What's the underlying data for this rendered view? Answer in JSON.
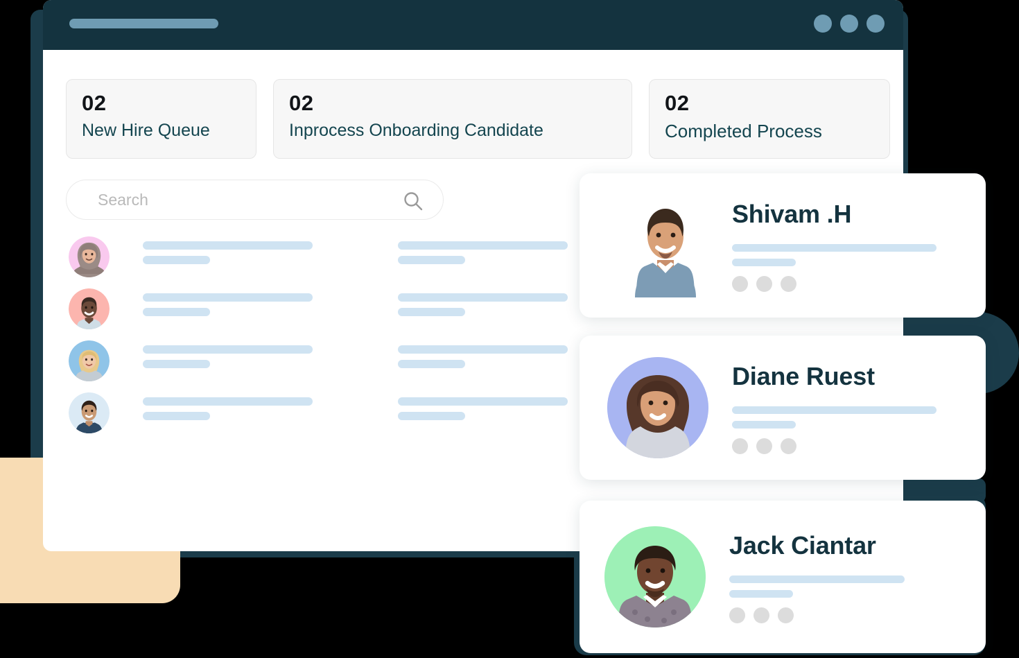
{
  "window": {
    "titlebar": {
      "pill": "",
      "dots": [
        "window-dot-1",
        "window-dot-2",
        "window-dot-3"
      ],
      "dot_color": "#6f9cb3",
      "background": "#14333f"
    }
  },
  "stats": [
    {
      "value": "02",
      "label": "New Hire Queue"
    },
    {
      "value": "02",
      "label": "Inprocess Onboarding Candidate"
    },
    {
      "value": "02",
      "label": "Completed Process"
    }
  ],
  "search": {
    "placeholder": "Search",
    "value": "",
    "icon": "search-icon"
  },
  "list_rows": [
    {
      "avatar_bg": "#f9c9ee",
      "avatar_name": "avatar-woman-hijab"
    },
    {
      "avatar_bg": "#fcb5ae",
      "avatar_name": "avatar-man-smiling"
    },
    {
      "avatar_bg": "#8fc4e8",
      "avatar_name": "avatar-woman-blonde"
    },
    {
      "avatar_bg": "#dbeaf5",
      "avatar_name": "avatar-man-young"
    }
  ],
  "profile_cards": [
    {
      "name": "Shivam .H",
      "avatar_bg": "#ffffff",
      "dots": 3
    },
    {
      "name": "Diane Ruest",
      "avatar_bg": "#a8b5f2",
      "dots": 3
    },
    {
      "name": "Jack Ciantar",
      "avatar_bg": "#9df0b6",
      "dots": 3
    }
  ],
  "colors": {
    "accent_dark": "#14333f",
    "shadow_plate": "#1b3c4a",
    "skeleton_blue": "#cfe3f2",
    "dot_gray": "#dcdcdc",
    "peach_block": "#f8dcb4",
    "card_bg": "#f7f7f7",
    "page_bg": "#000000"
  }
}
